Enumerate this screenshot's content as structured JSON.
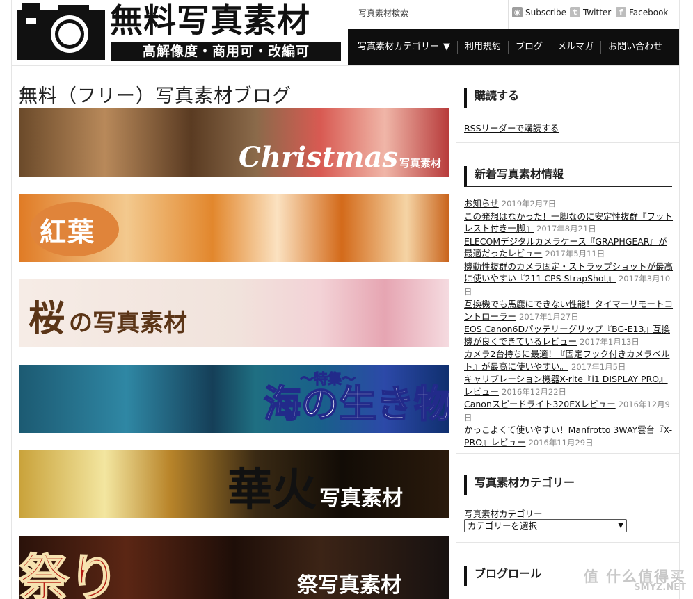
{
  "header": {
    "logo_title": "無料写真素材",
    "logo_subtitle": "高解像度・商用可・改編可",
    "search_link": "写真素材検索",
    "social": [
      {
        "label": "Subscribe",
        "icon": "rss-icon"
      },
      {
        "label": "Twitter",
        "icon": "twitter-icon"
      },
      {
        "label": "Facebook",
        "icon": "facebook-icon"
      }
    ],
    "nav": [
      {
        "label": "写真素材カテゴリー",
        "arrow": "▼"
      },
      {
        "label": "利用規約"
      },
      {
        "label": "ブログ"
      },
      {
        "label": "メルマガ"
      },
      {
        "label": "お問い合わせ"
      }
    ]
  },
  "main": {
    "title": "無料（フリー）写真素材ブログ",
    "banners": [
      {
        "text": "Christmas",
        "sub": "写真素材"
      },
      {
        "text": "紅葉"
      },
      {
        "text": "桜",
        "sub": "の写真素材"
      },
      {
        "text": "海の生き物",
        "sub": "～特集～"
      },
      {
        "text": "華火",
        "sub": "写真素材"
      },
      {
        "text": "祭り",
        "sub": "祭写真素材"
      }
    ]
  },
  "sidebar": {
    "subscribe_title": "購読する",
    "rss_link": "RSSリーダーで購読する",
    "news_title": "新着写真素材情報",
    "news": [
      {
        "title": "お知らせ",
        "date": "2019年2月7日"
      },
      {
        "title": "この発想はなかった！一脚なのに安定性抜群『フットレスト付き一脚』",
        "date": "2017年8月21日"
      },
      {
        "title": "ELECOMデジタルカメラケース『GRAPHGEAR』が最適だったレビュー",
        "date": "2017年5月11日"
      },
      {
        "title": "機動性抜群のカメラ固定・ストラップショットが最高に使いやすい『211 CPS StrapShot』",
        "date": "2017年3月10日"
      },
      {
        "title": "互換機でも馬鹿にできない性能！タイマーリモートコントローラー",
        "date": "2017年1月27日"
      },
      {
        "title": "EOS Canon6Dバッテリーグリップ『BG-E13』互換機が良くできているレビュー",
        "date": "2017年1月13日"
      },
      {
        "title": "カメラ2台持ちに最適！『固定フック付きカメラベルト』が最高に使いやすい。",
        "date": "2017年1月5日"
      },
      {
        "title": "キャリブレーション機器X-rite『i1 DISPLAY PRO』レビュー",
        "date": "2016年12月22日"
      },
      {
        "title": "Canonスピードライト320EXレビュー",
        "date": "2016年12月9日"
      },
      {
        "title": "かっこよくて使いやすい！Manfrotto 3WAY雲台『X-PRO』レビュー",
        "date": "2016年11月29日"
      }
    ],
    "category_title": "写真素材カテゴリー",
    "category_label": "写真素材カテゴリー",
    "category_select": "カテゴリーを選択",
    "blogroll_title": "ブログロール"
  },
  "watermark": {
    "line1": "值 什么值得买",
    "line2": "SMYZ.NET"
  }
}
